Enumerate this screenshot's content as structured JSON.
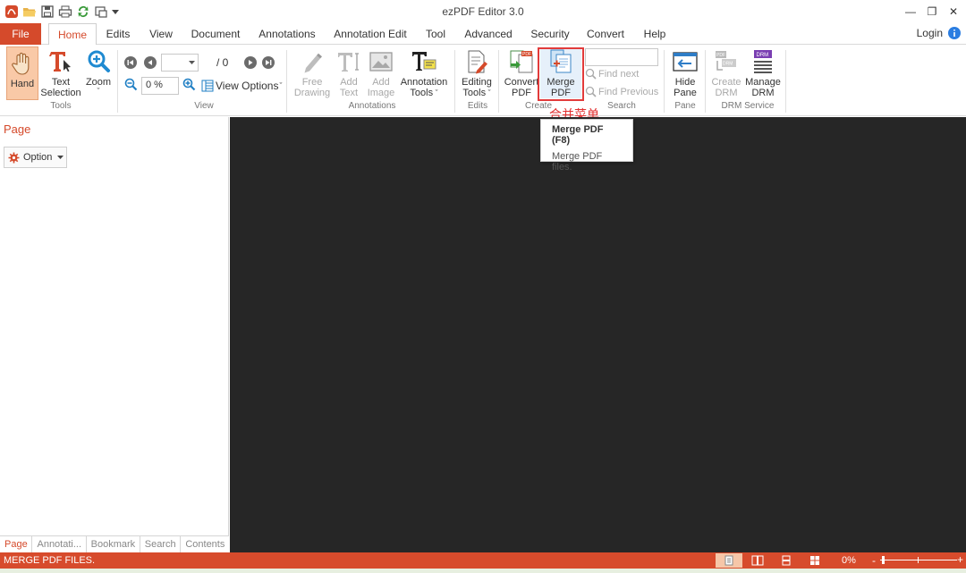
{
  "app": {
    "title": "ezPDF Editor 3.0"
  },
  "window": {
    "minimize": "—",
    "restore": "❐",
    "close": "✕"
  },
  "tabs": [
    {
      "label": "File"
    },
    {
      "label": "Home"
    },
    {
      "label": "Edits"
    },
    {
      "label": "View"
    },
    {
      "label": "Document"
    },
    {
      "label": "Annotations"
    },
    {
      "label": "Annotation Edit"
    },
    {
      "label": "Tool"
    },
    {
      "label": "Advanced"
    },
    {
      "label": "Security"
    },
    {
      "label": "Convert"
    },
    {
      "label": "Help"
    }
  ],
  "login": {
    "label": "Login"
  },
  "ribbon": {
    "tools": {
      "hand": "Hand",
      "text_selection_1": "Text",
      "text_selection_2": "Selection",
      "zoom": "Zoom",
      "group": "Tools"
    },
    "view": {
      "page_total": "/ 0",
      "zoom_value": "0 %",
      "view_options": "View Options",
      "group": "View"
    },
    "annotations": {
      "free_drawing_1": "Free",
      "free_drawing_2": "Drawing",
      "add_text_1": "Add",
      "add_text_2": "Text",
      "add_image_1": "Add",
      "add_image_2": "Image",
      "annotation_tools_1": "Annotation",
      "annotation_tools_2": "Tools",
      "group": "Annotations"
    },
    "edits": {
      "editing_tools_1": "Editing",
      "editing_tools_2": "Tools",
      "group": "Edits"
    },
    "create": {
      "convert_pdf_1": "Convert",
      "convert_pdf_2": "PDF",
      "merge_pdf_1": "Merge",
      "merge_pdf_2": "PDF",
      "group": "Create"
    },
    "search": {
      "find_next": "Find next",
      "find_previous": "Find Previous",
      "group": "Search"
    },
    "pane": {
      "hide_pane_1": "Hide",
      "hide_pane_2": "Pane",
      "group": "Pane"
    },
    "drm": {
      "create_drm_1": "Create",
      "create_drm_2": "DRM",
      "manage_drm_1": "Manage",
      "manage_drm_2": "DRM",
      "group": "DRM Service"
    }
  },
  "annotation_note": "合并菜单",
  "tooltip": {
    "title": "Merge PDF (F8)",
    "description": "Merge PDF files."
  },
  "left_pane": {
    "title": "Page",
    "option": "Option",
    "tabs": [
      "Page",
      "Annotati...",
      "Bookmark",
      "Search",
      "Contents"
    ]
  },
  "status": {
    "text": "MERGE PDF FILES.",
    "zoom": "0%",
    "zoom_minus": "-",
    "zoom_plus": "+"
  },
  "colors": {
    "accent": "#d54a2b",
    "highlight_box": "#e23b3b",
    "main_bg": "#262626"
  }
}
